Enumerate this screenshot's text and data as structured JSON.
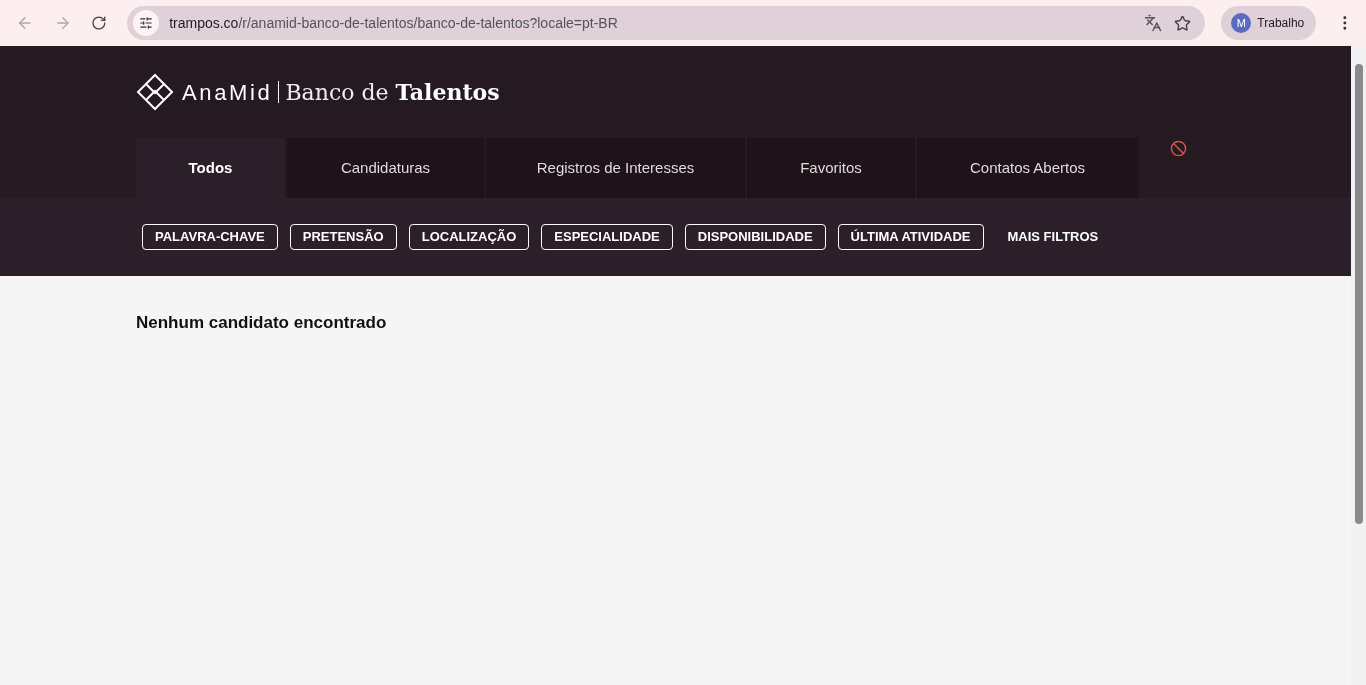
{
  "browser": {
    "url_host": "trampos.co",
    "url_path": "/r/anamid-banco-de-talentos/banco-de-talentos?locale=pt-BR",
    "profile_initial": "M",
    "profile_name": "Trabalho"
  },
  "header": {
    "brand": "AnaMid",
    "title_prefix": "Banco de ",
    "title_bold": "Talentos"
  },
  "tabs": [
    {
      "label": "Todos",
      "selected": true
    },
    {
      "label": "Candidaturas",
      "selected": false
    },
    {
      "label": "Registros de Interesses",
      "selected": false
    },
    {
      "label": "Favoritos",
      "selected": false
    },
    {
      "label": "Contatos Abertos",
      "selected": false
    }
  ],
  "filters": [
    {
      "label": "PALAVRA-CHAVE",
      "kind": "outlined"
    },
    {
      "label": "PRETENSÃO",
      "kind": "outlined"
    },
    {
      "label": "LOCALIZAÇÃO",
      "kind": "outlined"
    },
    {
      "label": "ESPECIALIDADE",
      "kind": "outlined"
    },
    {
      "label": "DISPONIBILIDADE",
      "kind": "outlined"
    },
    {
      "label": "ÚLTIMA ATIVIDADE",
      "kind": "outlined"
    },
    {
      "label": "MAIS FILTROS",
      "kind": "plain"
    }
  ],
  "empty_message": "Nenhum candidato encontrado"
}
